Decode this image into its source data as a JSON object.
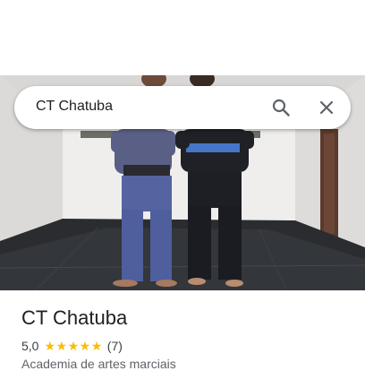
{
  "search": {
    "query": "CT Chatuba",
    "search_icon": "search-icon",
    "close_icon": "close-icon"
  },
  "photo": {
    "kind": "place-photo",
    "description_icon": "photo"
  },
  "place": {
    "title": "CT Chatuba",
    "rating": "5,0",
    "stars": 5,
    "review_count": "(7)",
    "category": "Academia de artes marciais"
  },
  "colors": {
    "star": "#fbbc04",
    "text_primary": "#202124",
    "text_secondary": "#5f6368",
    "icon": "#5f6368"
  }
}
